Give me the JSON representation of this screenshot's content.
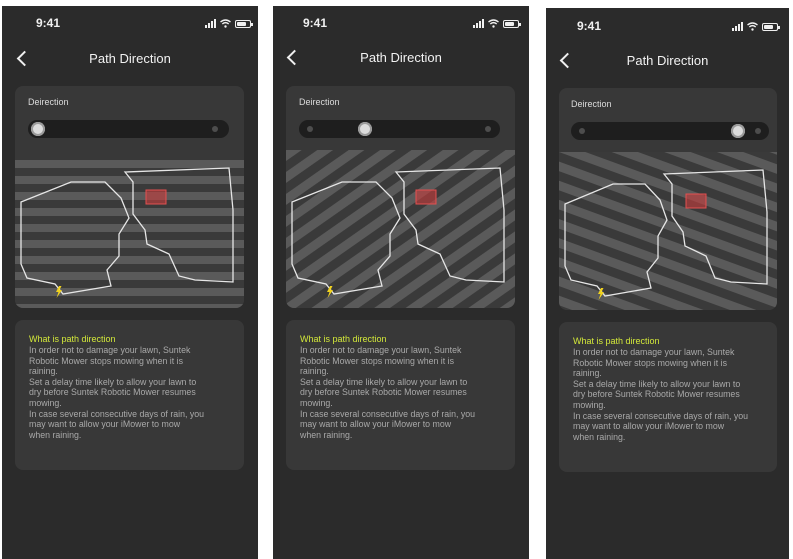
{
  "screens": [
    {
      "status_time": "9:41",
      "title": "Path Direction",
      "card_label": "Deirection",
      "direction_option": "horizontal",
      "info_title": "What is path direction",
      "info_body": "In order not to damage your lawn, Suntek\nRobotic Mower stops mowing when it is\nraining.\nSet a delay time likely to allow your lawn to\ndry before Suntek Robotic Mower resumes\nmowing.\nIn case several consecutive days of rain, you\nmay want to allow your iMower to mow\nwhen raining."
    },
    {
      "status_time": "9:41",
      "title": "Path Direction",
      "card_label": "Deirection",
      "direction_option": "diagonal-steep",
      "info_title": "What is path direction",
      "info_body": "In order not to damage your lawn, Suntek\nRobotic Mower stops mowing when it is\nraining.\nSet a delay time likely to allow your lawn to\ndry before Suntek Robotic Mower resumes\nmowing.\nIn case several consecutive days of rain, you\nmay want to allow your iMower to mow\nwhen raining."
    },
    {
      "status_time": "9:41",
      "title": "Path Direction",
      "card_label": "Deirection",
      "direction_option": "diagonal-shallow",
      "info_title": "What is path direction",
      "info_body": "In order not to damage your lawn, Suntek\nRobotic Mower stops mowing when it is\nraining.\nSet a delay time likely to allow your lawn to\ndry before Suntek Robotic Mower resumes\nmowing.\nIn case several consecutive days of rain, you\nmay want to allow your iMower to mow\nwhen raining."
    }
  ],
  "colors": {
    "background": "#2b2b2b",
    "card": "#383838",
    "accent_title": "#d3e83a",
    "no_go_zone": "#c83c3c",
    "charger": "#f0d21e"
  },
  "icons": [
    "back-chevron-icon",
    "signal-icon",
    "wifi-icon",
    "battery-icon",
    "charging-station-icon"
  ]
}
